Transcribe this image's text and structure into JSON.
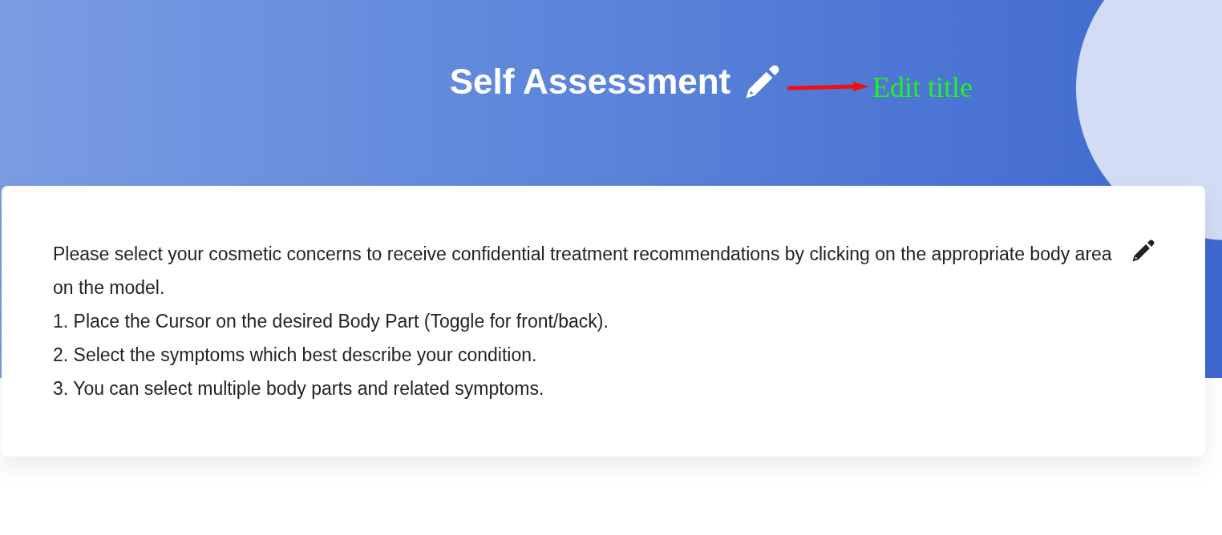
{
  "header": {
    "title": "Self Assessment"
  },
  "annotation": {
    "text": "Edit title"
  },
  "card": {
    "intro": "Please select your cosmetic concerns to receive confidential treatment recommendations by clicking on the appropriate body area on the model.",
    "steps": [
      "1. Place the Cursor on the desired Body Part (Toggle for front/back).",
      "2. Select the symptoms which best describe your condition.",
      "3. You can select multiple body parts and related symptoms."
    ]
  }
}
